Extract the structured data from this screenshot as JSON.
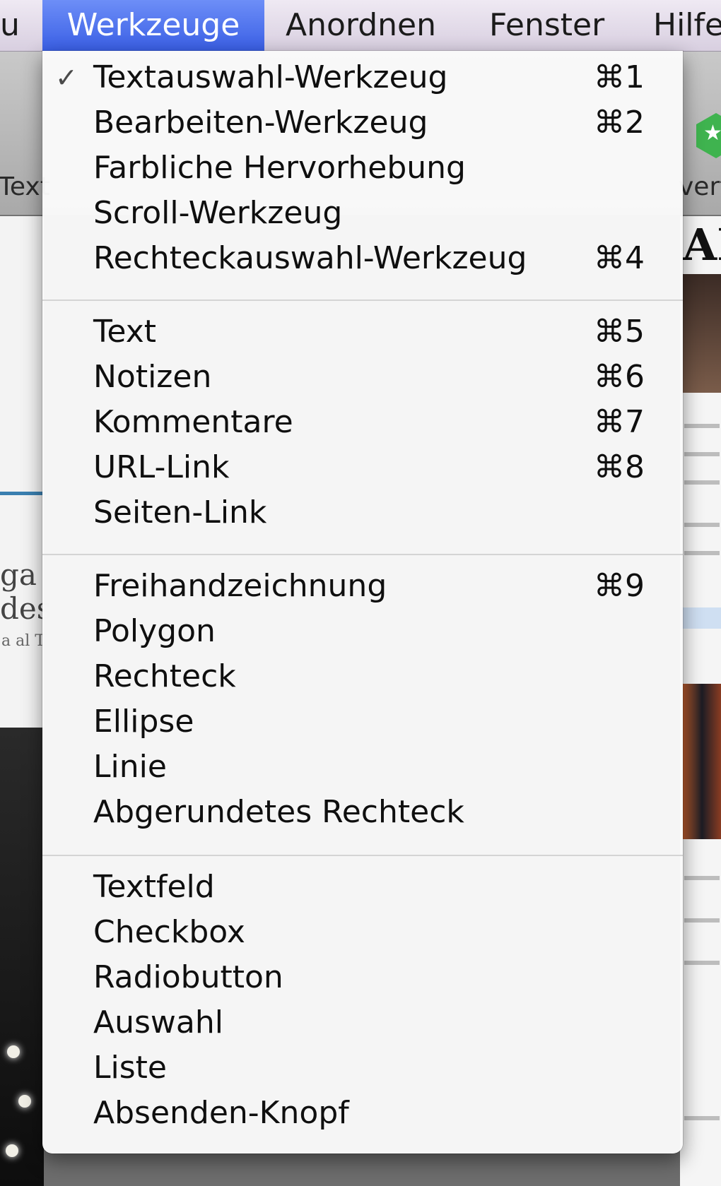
{
  "menubar": {
    "items": [
      {
        "label": "u"
      },
      {
        "label": "Werkzeuge"
      },
      {
        "label": "Anordnen"
      },
      {
        "label": "Fenster"
      },
      {
        "label": "Hilfe"
      }
    ]
  },
  "toolbar": {
    "left_label": "Text",
    "right_label": "vert"
  },
  "background_doc": {
    "left_snippet_line1": "ga",
    "left_snippet_line2": "des",
    "left_small_text": "a al T",
    "right_masthead": "AI"
  },
  "menu": {
    "groups": [
      {
        "items": [
          {
            "label": "Textauswahl-Werkzeug",
            "shortcut": "⌘1",
            "checked": true
          },
          {
            "label": "Bearbeiten-Werkzeug",
            "shortcut": "⌘2"
          },
          {
            "label": "Farbliche Hervorhebung",
            "shortcut": ""
          },
          {
            "label": "Scroll-Werkzeug",
            "shortcut": ""
          },
          {
            "label": "Rechteckauswahl-Werkzeug",
            "shortcut": "⌘4"
          }
        ]
      },
      {
        "items": [
          {
            "label": "Text",
            "shortcut": "⌘5"
          },
          {
            "label": "Notizen",
            "shortcut": "⌘6"
          },
          {
            "label": "Kommentare",
            "shortcut": "⌘7"
          },
          {
            "label": "URL-Link",
            "shortcut": "⌘8"
          },
          {
            "label": "Seiten-Link",
            "shortcut": ""
          }
        ]
      },
      {
        "items": [
          {
            "label": "Freihandzeichnung",
            "shortcut": "⌘9"
          },
          {
            "label": "Polygon",
            "shortcut": ""
          },
          {
            "label": "Rechteck",
            "shortcut": ""
          },
          {
            "label": "Ellipse",
            "shortcut": ""
          },
          {
            "label": "Linie",
            "shortcut": ""
          },
          {
            "label": "Abgerundetes Rechteck",
            "shortcut": ""
          }
        ]
      },
      {
        "items": [
          {
            "label": "Textfeld",
            "shortcut": ""
          },
          {
            "label": "Checkbox",
            "shortcut": ""
          },
          {
            "label": "Radiobutton",
            "shortcut": ""
          },
          {
            "label": "Auswahl",
            "shortcut": ""
          },
          {
            "label": "Liste",
            "shortcut": ""
          },
          {
            "label": "Absenden-Knopf",
            "shortcut": ""
          }
        ]
      }
    ],
    "check_mark": "✓"
  },
  "colors": {
    "menubar_active": "#3a5fe5",
    "menu_background": "#fafafa",
    "separator": "#d4d4d4",
    "toolbar_icon": "#3fb34f"
  },
  "icons": {
    "toolbar_right": "star-badge-icon"
  }
}
